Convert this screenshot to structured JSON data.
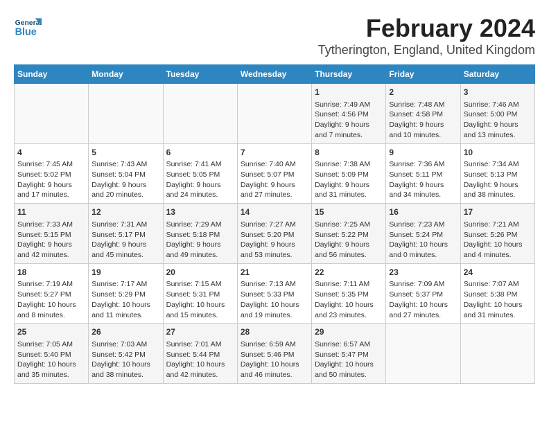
{
  "header": {
    "logo_general": "General",
    "logo_blue": "Blue",
    "title": "February 2024",
    "subtitle": "Tytherington, England, United Kingdom"
  },
  "calendar": {
    "days_of_week": [
      "Sunday",
      "Monday",
      "Tuesday",
      "Wednesday",
      "Thursday",
      "Friday",
      "Saturday"
    ],
    "weeks": [
      [
        {
          "day": "",
          "info": ""
        },
        {
          "day": "",
          "info": ""
        },
        {
          "day": "",
          "info": ""
        },
        {
          "day": "",
          "info": ""
        },
        {
          "day": "1",
          "info": "Sunrise: 7:49 AM\nSunset: 4:56 PM\nDaylight: 9 hours\nand 7 minutes."
        },
        {
          "day": "2",
          "info": "Sunrise: 7:48 AM\nSunset: 4:58 PM\nDaylight: 9 hours\nand 10 minutes."
        },
        {
          "day": "3",
          "info": "Sunrise: 7:46 AM\nSunset: 5:00 PM\nDaylight: 9 hours\nand 13 minutes."
        }
      ],
      [
        {
          "day": "4",
          "info": "Sunrise: 7:45 AM\nSunset: 5:02 PM\nDaylight: 9 hours\nand 17 minutes."
        },
        {
          "day": "5",
          "info": "Sunrise: 7:43 AM\nSunset: 5:04 PM\nDaylight: 9 hours\nand 20 minutes."
        },
        {
          "day": "6",
          "info": "Sunrise: 7:41 AM\nSunset: 5:05 PM\nDaylight: 9 hours\nand 24 minutes."
        },
        {
          "day": "7",
          "info": "Sunrise: 7:40 AM\nSunset: 5:07 PM\nDaylight: 9 hours\nand 27 minutes."
        },
        {
          "day": "8",
          "info": "Sunrise: 7:38 AM\nSunset: 5:09 PM\nDaylight: 9 hours\nand 31 minutes."
        },
        {
          "day": "9",
          "info": "Sunrise: 7:36 AM\nSunset: 5:11 PM\nDaylight: 9 hours\nand 34 minutes."
        },
        {
          "day": "10",
          "info": "Sunrise: 7:34 AM\nSunset: 5:13 PM\nDaylight: 9 hours\nand 38 minutes."
        }
      ],
      [
        {
          "day": "11",
          "info": "Sunrise: 7:33 AM\nSunset: 5:15 PM\nDaylight: 9 hours\nand 42 minutes."
        },
        {
          "day": "12",
          "info": "Sunrise: 7:31 AM\nSunset: 5:17 PM\nDaylight: 9 hours\nand 45 minutes."
        },
        {
          "day": "13",
          "info": "Sunrise: 7:29 AM\nSunset: 5:18 PM\nDaylight: 9 hours\nand 49 minutes."
        },
        {
          "day": "14",
          "info": "Sunrise: 7:27 AM\nSunset: 5:20 PM\nDaylight: 9 hours\nand 53 minutes."
        },
        {
          "day": "15",
          "info": "Sunrise: 7:25 AM\nSunset: 5:22 PM\nDaylight: 9 hours\nand 56 minutes."
        },
        {
          "day": "16",
          "info": "Sunrise: 7:23 AM\nSunset: 5:24 PM\nDaylight: 10 hours\nand 0 minutes."
        },
        {
          "day": "17",
          "info": "Sunrise: 7:21 AM\nSunset: 5:26 PM\nDaylight: 10 hours\nand 4 minutes."
        }
      ],
      [
        {
          "day": "18",
          "info": "Sunrise: 7:19 AM\nSunset: 5:27 PM\nDaylight: 10 hours\nand 8 minutes."
        },
        {
          "day": "19",
          "info": "Sunrise: 7:17 AM\nSunset: 5:29 PM\nDaylight: 10 hours\nand 11 minutes."
        },
        {
          "day": "20",
          "info": "Sunrise: 7:15 AM\nSunset: 5:31 PM\nDaylight: 10 hours\nand 15 minutes."
        },
        {
          "day": "21",
          "info": "Sunrise: 7:13 AM\nSunset: 5:33 PM\nDaylight: 10 hours\nand 19 minutes."
        },
        {
          "day": "22",
          "info": "Sunrise: 7:11 AM\nSunset: 5:35 PM\nDaylight: 10 hours\nand 23 minutes."
        },
        {
          "day": "23",
          "info": "Sunrise: 7:09 AM\nSunset: 5:37 PM\nDaylight: 10 hours\nand 27 minutes."
        },
        {
          "day": "24",
          "info": "Sunrise: 7:07 AM\nSunset: 5:38 PM\nDaylight: 10 hours\nand 31 minutes."
        }
      ],
      [
        {
          "day": "25",
          "info": "Sunrise: 7:05 AM\nSunset: 5:40 PM\nDaylight: 10 hours\nand 35 minutes."
        },
        {
          "day": "26",
          "info": "Sunrise: 7:03 AM\nSunset: 5:42 PM\nDaylight: 10 hours\nand 38 minutes."
        },
        {
          "day": "27",
          "info": "Sunrise: 7:01 AM\nSunset: 5:44 PM\nDaylight: 10 hours\nand 42 minutes."
        },
        {
          "day": "28",
          "info": "Sunrise: 6:59 AM\nSunset: 5:46 PM\nDaylight: 10 hours\nand 46 minutes."
        },
        {
          "day": "29",
          "info": "Sunrise: 6:57 AM\nSunset: 5:47 PM\nDaylight: 10 hours\nand 50 minutes."
        },
        {
          "day": "",
          "info": ""
        },
        {
          "day": "",
          "info": ""
        }
      ]
    ]
  }
}
